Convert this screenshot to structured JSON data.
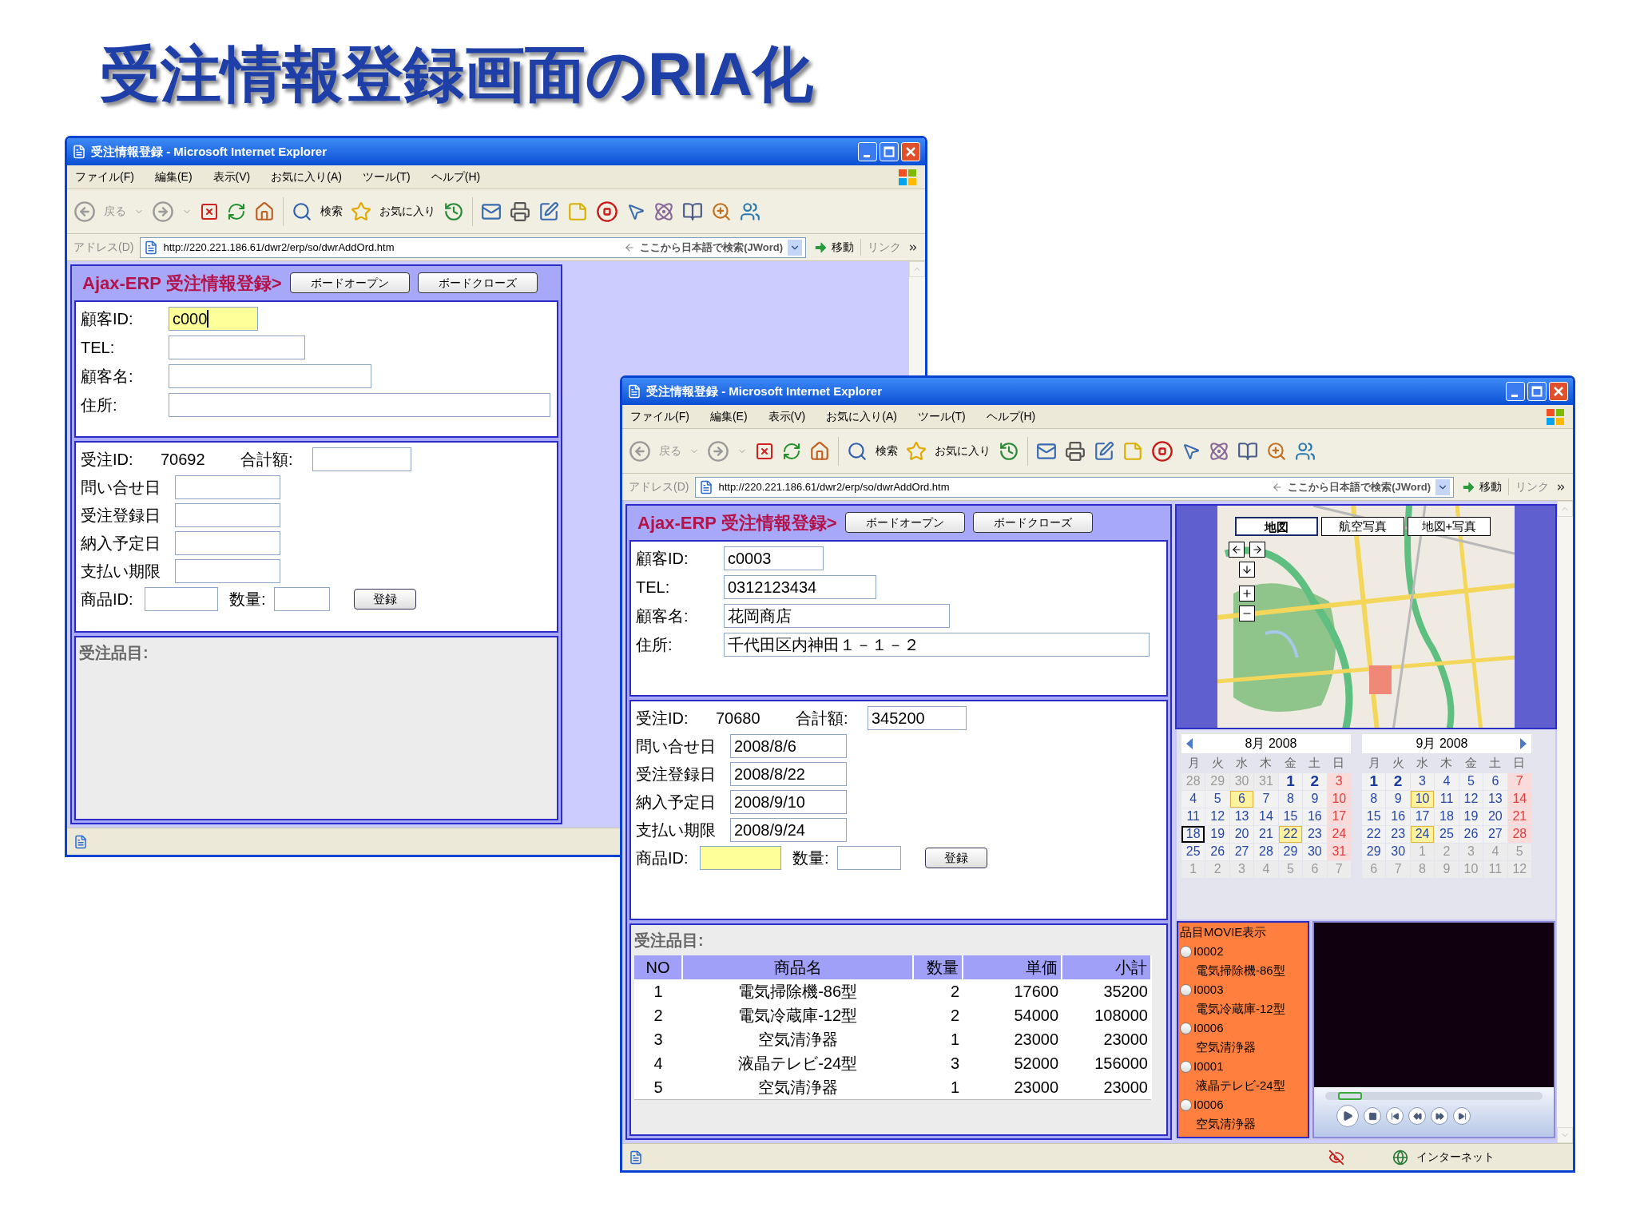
{
  "slide_title": "受注情報登録画面のRIA化",
  "windows": [
    {
      "title": "受注情報登録 - Microsoft Internet Explorer",
      "menu": [
        "ファイル(F)",
        "編集(E)",
        "表示(V)",
        "お気に入り(A)",
        "ツール(T)",
        "ヘルプ(H)"
      ],
      "toolbar": {
        "back": "戻る",
        "search": "検索",
        "favorites": "お気に入り"
      },
      "address": {
        "label": "アドレス(D)",
        "url": "http://220.221.186.61/dwr2/erp/so/dwrAddOrd.htm",
        "search_hint": "ここから日本語で検索(JWord)",
        "go": "移動",
        "links": "リンク"
      },
      "page": {
        "heading": "Ajax-ERP 受注情報登録>",
        "buttons": [
          "ボードオープン",
          "ボードクローズ"
        ],
        "customer": [
          {
            "label": "顧客ID:",
            "value": "c000",
            "focused": true
          },
          {
            "label": "TEL:",
            "focused": false
          },
          {
            "label": "顧客名:",
            "focused": false
          },
          {
            "label": "住所:",
            "focused": false
          }
        ],
        "order": {
          "id_label": "受注ID:",
          "id": "70692",
          "total_label": "合計額:"
        },
        "dates": [
          {
            "label": "問い合せ日"
          },
          {
            "label": "受注登録日"
          },
          {
            "label": "納入予定日"
          },
          {
            "label": "支払い期限"
          }
        ],
        "product": {
          "label": "商品ID:",
          "focused": false
        },
        "quantity": {
          "label": "数量:"
        },
        "submit": "登録",
        "items": {
          "label": "受注品目:"
        }
      }
    },
    {
      "title": "受注情報登録 - Microsoft Internet Explorer",
      "menu": [
        "ファイル(F)",
        "編集(E)",
        "表示(V)",
        "お気に入り(A)",
        "ツール(T)",
        "ヘルプ(H)"
      ],
      "toolbar": {
        "back": "戻る",
        "search": "検索",
        "favorites": "お気に入り"
      },
      "address": {
        "label": "アドレス(D)",
        "url": "http://220.221.186.61/dwr2/erp/so/dwrAddOrd.htm",
        "search_hint": "ここから日本語で検索(JWord)",
        "go": "移動",
        "links": "リンク"
      },
      "page": {
        "heading": "Ajax-ERP 受注情報登録>",
        "buttons": [
          "ボードオープン",
          "ボードクローズ"
        ],
        "customer": [
          {
            "label": "顧客ID:",
            "value": "c0003",
            "focused": false
          },
          {
            "label": "TEL:",
            "value": "0312123434",
            "focused": false
          },
          {
            "label": "顧客名:",
            "value": "花岡商店",
            "focused": false
          },
          {
            "label": "住所:",
            "value": "千代田区内神田１－１－２",
            "focused": false
          }
        ],
        "order": {
          "id_label": "受注ID:",
          "id": "70680",
          "total_label": "合計額:",
          "total": "345200"
        },
        "dates": [
          {
            "label": "問い合せ日",
            "value": "2008/8/6"
          },
          {
            "label": "受注登録日",
            "value": "2008/8/22"
          },
          {
            "label": "納入予定日",
            "value": "2008/9/10"
          },
          {
            "label": "支払い期限",
            "value": "2008/9/24"
          }
        ],
        "product": {
          "label": "商品ID:",
          "focused": true
        },
        "quantity": {
          "label": "数量:"
        },
        "submit": "登録",
        "items": {
          "label": "受注品目:",
          "table": {
            "columns": [
              "NO",
              "商品名",
              "数量",
              "単価",
              "小計"
            ],
            "rows": [
              [
                "1",
                "電気掃除機-86型",
                "2",
                "17600",
                "35200"
              ],
              [
                "2",
                "電気冷蔵庫-12型",
                "2",
                "54000",
                "108000"
              ],
              [
                "3",
                "空気清浄器",
                "1",
                "23000",
                "23000"
              ],
              [
                "4",
                "液晶テレビ-24型",
                "3",
                "52000",
                "156000"
              ],
              [
                "5",
                "空気清浄器",
                "1",
                "23000",
                "23000"
              ]
            ]
          }
        }
      },
      "side_panel": {
        "map": {
          "kind": "picture",
          "tabs": [
            {
              "label": "地図",
              "selected": true
            },
            {
              "label": "航空写真",
              "selected": false
            },
            {
              "label": "地図+写真",
              "selected": false
            }
          ]
        },
        "calendars": [
          {
            "title": "8月 2008",
            "weekdays": [
              "月",
              "火",
              "水",
              "木",
              "金",
              "土",
              "日"
            ],
            "weeks": [
              [
                {
                  "d": "28",
                  "kind": "other"
                },
                {
                  "d": "29",
                  "kind": "other"
                },
                {
                  "d": "30",
                  "kind": "other"
                },
                {
                  "d": "31",
                  "kind": "other"
                },
                {
                  "d": "1",
                  "kind": "bold"
                },
                {
                  "d": "2",
                  "kind": "bold"
                },
                {
                  "d": "3",
                  "kind": "sunday"
                }
              ],
              [
                {
                  "d": "4",
                  "kind": "day"
                },
                {
                  "d": "5",
                  "kind": "day"
                },
                {
                  "d": "6",
                  "kind": "marked"
                },
                {
                  "d": "7",
                  "kind": "day"
                },
                {
                  "d": "8",
                  "kind": "day"
                },
                {
                  "d": "9",
                  "kind": "day"
                },
                {
                  "d": "10",
                  "kind": "sunday"
                }
              ],
              [
                {
                  "d": "11",
                  "kind": "day"
                },
                {
                  "d": "12",
                  "kind": "day"
                },
                {
                  "d": "13",
                  "kind": "day"
                },
                {
                  "d": "14",
                  "kind": "day"
                },
                {
                  "d": "15",
                  "kind": "day"
                },
                {
                  "d": "16",
                  "kind": "day"
                },
                {
                  "d": "17",
                  "kind": "sunday"
                }
              ],
              [
                {
                  "d": "18",
                  "kind": "today"
                },
                {
                  "d": "19",
                  "kind": "day"
                },
                {
                  "d": "20",
                  "kind": "day"
                },
                {
                  "d": "21",
                  "kind": "day"
                },
                {
                  "d": "22",
                  "kind": "marked"
                },
                {
                  "d": "23",
                  "kind": "day"
                },
                {
                  "d": "24",
                  "kind": "sunday"
                }
              ],
              [
                {
                  "d": "25",
                  "kind": "day"
                },
                {
                  "d": "26",
                  "kind": "day"
                },
                {
                  "d": "27",
                  "kind": "day"
                },
                {
                  "d": "28",
                  "kind": "day"
                },
                {
                  "d": "29",
                  "kind": "day"
                },
                {
                  "d": "30",
                  "kind": "day"
                },
                {
                  "d": "31",
                  "kind": "sunday"
                }
              ],
              [
                {
                  "d": "1",
                  "kind": "other"
                },
                {
                  "d": "2",
                  "kind": "other"
                },
                {
                  "d": "3",
                  "kind": "other"
                },
                {
                  "d": "4",
                  "kind": "other"
                },
                {
                  "d": "5",
                  "kind": "other"
                },
                {
                  "d": "6",
                  "kind": "other"
                },
                {
                  "d": "7",
                  "kind": "other"
                }
              ]
            ]
          },
          {
            "title": "9月 2008",
            "weekdays": [
              "月",
              "火",
              "水",
              "木",
              "金",
              "土",
              "日"
            ],
            "weeks": [
              [
                {
                  "d": "1",
                  "kind": "bold"
                },
                {
                  "d": "2",
                  "kind": "bold"
                },
                {
                  "d": "3",
                  "kind": "day"
                },
                {
                  "d": "4",
                  "kind": "day"
                },
                {
                  "d": "5",
                  "kind": "day"
                },
                {
                  "d": "6",
                  "kind": "day"
                },
                {
                  "d": "7",
                  "kind": "sunday"
                }
              ],
              [
                {
                  "d": "8",
                  "kind": "day"
                },
                {
                  "d": "9",
                  "kind": "day"
                },
                {
                  "d": "10",
                  "kind": "marked"
                },
                {
                  "d": "11",
                  "kind": "day"
                },
                {
                  "d": "12",
                  "kind": "day"
                },
                {
                  "d": "13",
                  "kind": "day"
                },
                {
                  "d": "14",
                  "kind": "sunday"
                }
              ],
              [
                {
                  "d": "15",
                  "kind": "day"
                },
                {
                  "d": "16",
                  "kind": "day"
                },
                {
                  "d": "17",
                  "kind": "day"
                },
                {
                  "d": "18",
                  "kind": "day"
                },
                {
                  "d": "19",
                  "kind": "day"
                },
                {
                  "d": "20",
                  "kind": "day"
                },
                {
                  "d": "21",
                  "kind": "sunday"
                }
              ],
              [
                {
                  "d": "22",
                  "kind": "day"
                },
                {
                  "d": "23",
                  "kind": "day"
                },
                {
                  "d": "24",
                  "kind": "marked"
                },
                {
                  "d": "25",
                  "kind": "day"
                },
                {
                  "d": "26",
                  "kind": "day"
                },
                {
                  "d": "27",
                  "kind": "day"
                },
                {
                  "d": "28",
                  "kind": "sunday"
                }
              ],
              [
                {
                  "d": "29",
                  "kind": "day"
                },
                {
                  "d": "30",
                  "kind": "day"
                },
                {
                  "d": "1",
                  "kind": "other"
                },
                {
                  "d": "2",
                  "kind": "other"
                },
                {
                  "d": "3",
                  "kind": "other"
                },
                {
                  "d": "4",
                  "kind": "other"
                },
                {
                  "d": "5",
                  "kind": "other"
                }
              ],
              [
                {
                  "d": "6",
                  "kind": "other"
                },
                {
                  "d": "7",
                  "kind": "other"
                },
                {
                  "d": "8",
                  "kind": "other"
                },
                {
                  "d": "9",
                  "kind": "other"
                },
                {
                  "d": "10",
                  "kind": "other"
                },
                {
                  "d": "11",
                  "kind": "other"
                },
                {
                  "d": "12",
                  "kind": "other"
                }
              ]
            ]
          }
        ],
        "movie": {
          "title": "品目MOVIE表示",
          "items": [
            {
              "id": "I0002",
              "name": "電気掃除機-86型",
              "selected": false
            },
            {
              "id": "I0003",
              "name": "電気冷蔵庫-12型",
              "selected": false
            },
            {
              "id": "I0006",
              "name": "空気清浄器",
              "selected": false
            },
            {
              "id": "I0001",
              "name": "液晶テレビ-24型",
              "selected": false
            },
            {
              "id": "I0006",
              "name": "空気清浄器",
              "selected": false
            }
          ],
          "player": {
            "level": 0.06
          }
        }
      },
      "status": {
        "zone": "インターネット"
      }
    }
  ]
}
